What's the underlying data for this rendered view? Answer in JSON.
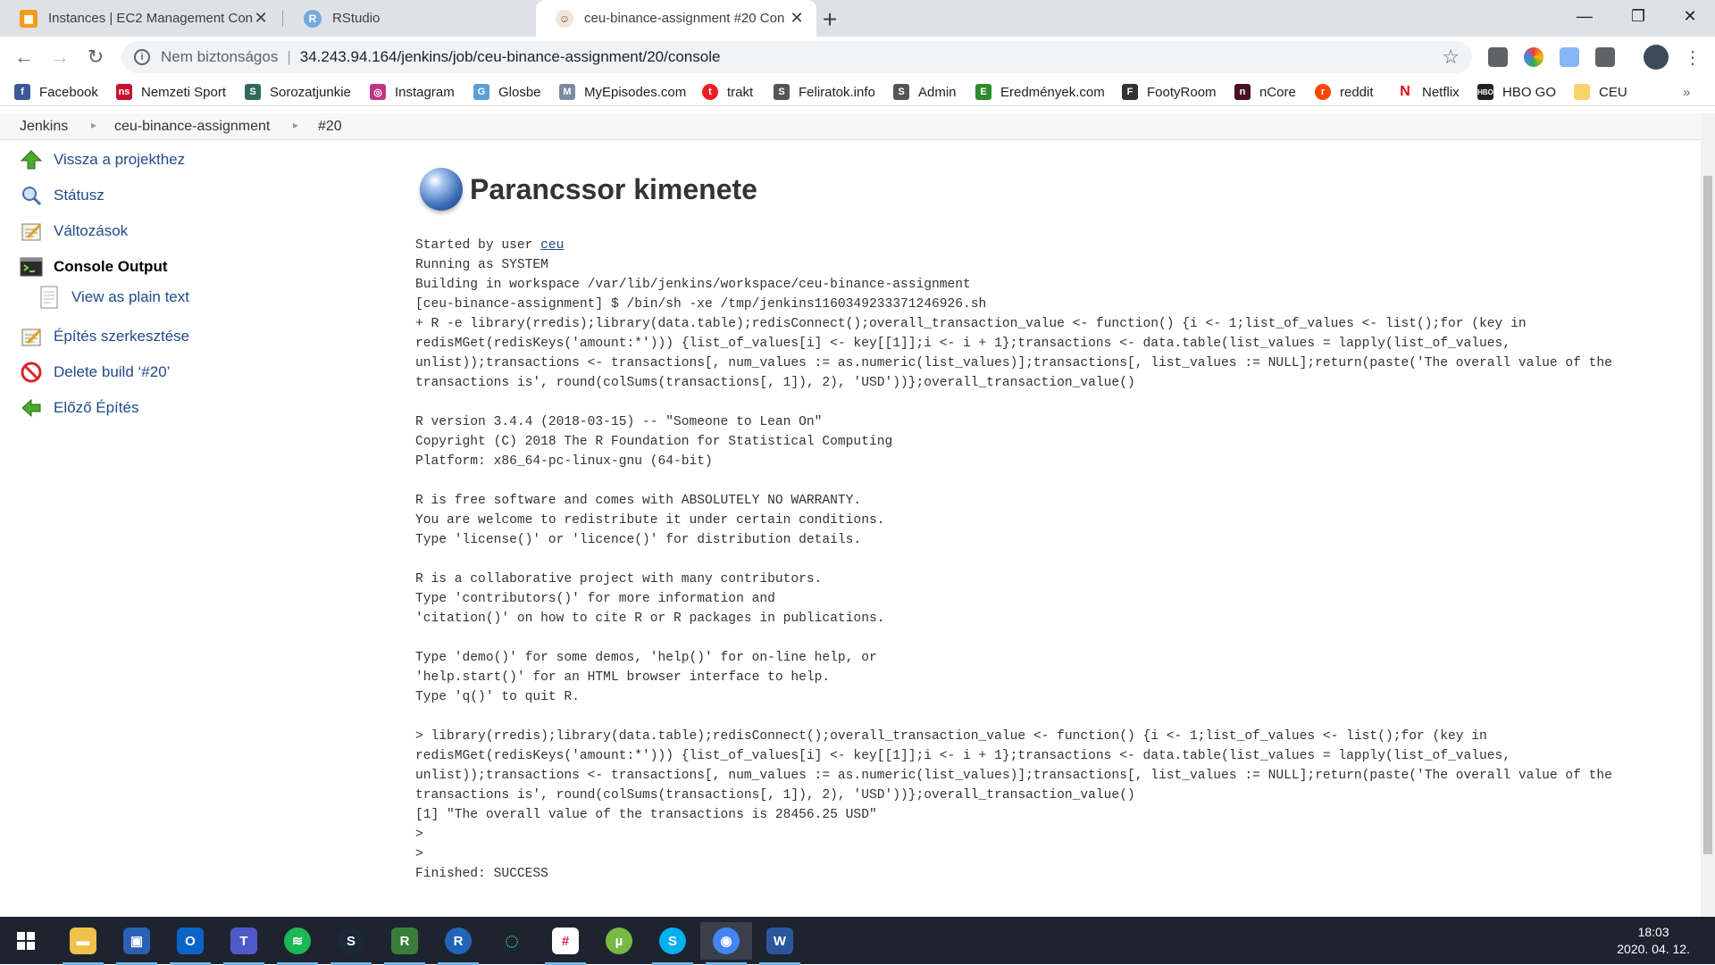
{
  "tabs": [
    {
      "title": "Instances | EC2 Management Con",
      "icon": "aws-icon",
      "color": "#f49b1c"
    },
    {
      "title": "RStudio",
      "icon": "rstudio-icon",
      "color": "#75aadb"
    },
    {
      "title": "ceu-binance-assignment #20 Con",
      "icon": "jenkins-icon",
      "color": "#d24939"
    }
  ],
  "omnibox": {
    "security_label": "Nem biztonságos",
    "url": "34.243.94.164/jenkins/job/ceu-binance-assignment/20/console"
  },
  "bookmarks": [
    {
      "label": "Facebook",
      "icon": "facebook-icon",
      "color": "#3b5998",
      "glyph": "f"
    },
    {
      "label": "Nemzeti Sport",
      "icon": "nemzeti-sport-icon",
      "color": "#c8102e",
      "glyph": "ns"
    },
    {
      "label": "Sorozatjunkie",
      "icon": "sorozatjunkie-icon",
      "color": "#2e6b5e",
      "glyph": "S"
    },
    {
      "label": "Instagram",
      "icon": "instagram-icon",
      "color": "#c13584",
      "glyph": "◎"
    },
    {
      "label": "Glosbe",
      "icon": "glosbe-icon",
      "color": "#5aa0d8",
      "glyph": "G"
    },
    {
      "label": "MyEpisodes.com",
      "icon": "myepisodes-icon",
      "color": "#7a8aa0",
      "glyph": "M"
    },
    {
      "label": "trakt",
      "icon": "trakt-icon",
      "color": "#ed1c24",
      "glyph": "t"
    },
    {
      "label": "Feliratok.info",
      "icon": "feliratok-icon",
      "color": "#555555",
      "glyph": "S"
    },
    {
      "label": "Admin",
      "icon": "admin-icon",
      "color": "#555555",
      "glyph": "S"
    },
    {
      "label": "Eredmények.com",
      "icon": "eredmenyek-icon",
      "color": "#2d8a2d",
      "glyph": "E"
    },
    {
      "label": "FootyRoom",
      "icon": "footyroom-icon",
      "color": "#333333",
      "glyph": "F"
    },
    {
      "label": "nCore",
      "icon": "ncore-icon",
      "color": "#4a0f22",
      "glyph": "n"
    },
    {
      "label": "reddit",
      "icon": "reddit-icon",
      "color": "#ff4500",
      "glyph": "r"
    },
    {
      "label": "Netflix",
      "icon": "netflix-icon",
      "color": "#e50914",
      "glyph": "N"
    },
    {
      "label": "HBO GO",
      "icon": "hbo-go-icon",
      "color": "#222222",
      "glyph": "H"
    },
    {
      "label": "CEU",
      "icon": "folder-icon",
      "color": "#f6d46b",
      "glyph": ""
    }
  ],
  "bookmarks_overflow": "»",
  "breadcrumb": [
    "Jenkins",
    "ceu-binance-assignment",
    "#20"
  ],
  "side_panel": [
    {
      "label": "Vissza a projekthez",
      "icon": "up-arrow-icon"
    },
    {
      "label": "Státusz",
      "icon": "search-icon"
    },
    {
      "label": "Változások",
      "icon": "notepad-icon"
    },
    {
      "label": "Console Output",
      "icon": "terminal-icon"
    },
    {
      "label": "View as plain text",
      "icon": "document-icon"
    },
    {
      "label": "Építés szerkesztése",
      "icon": "notepad-icon"
    },
    {
      "label": "Delete build ‘#20’",
      "icon": "no-entry-icon"
    },
    {
      "label": "Előző Építés",
      "icon": "left-arrow-icon"
    }
  ],
  "page_title": "Parancssor kimenete",
  "console": {
    "started_prefix": "Started by user ",
    "started_user": "ceu",
    "output": "Running as SYSTEM\nBuilding in workspace /var/lib/jenkins/workspace/ceu-binance-assignment\n[ceu-binance-assignment] $ /bin/sh -xe /tmp/jenkins1160349233371246926.sh\n+ R -e library(rredis);library(data.table);redisConnect();overall_transaction_value <- function() {i <- 1;list_of_values <- list();for (key in\nredisMGet(redisKeys('amount:*'))) {list_of_values[i] <- key[[1]];i <- i + 1};transactions <- data.table(list_values = lapply(list_of_values,\nunlist));transactions <- transactions[, num_values := as.numeric(list_values)];transactions[, list_values := NULL];return(paste('The overall value of the\ntransactions is', round(colSums(transactions[, 1]), 2), 'USD'))};overall_transaction_value()\n\nR version 3.4.4 (2018-03-15) -- \"Someone to Lean On\"\nCopyright (C) 2018 The R Foundation for Statistical Computing\nPlatform: x86_64-pc-linux-gnu (64-bit)\n\nR is free software and comes with ABSOLUTELY NO WARRANTY.\nYou are welcome to redistribute it under certain conditions.\nType 'license()' or 'licence()' for distribution details.\n\nR is a collaborative project with many contributors.\nType 'contributors()' for more information and\n'citation()' on how to cite R or R packages in publications.\n\nType 'demo()' for some demos, 'help()' for on-line help, or\n'help.start()' for an HTML browser interface to help.\nType 'q()' to quit R.\n\n> library(rredis);library(data.table);redisConnect();overall_transaction_value <- function() {i <- 1;list_of_values <- list();for (key in\nredisMGet(redisKeys('amount:*'))) {list_of_values[i] <- key[[1]];i <- i + 1};transactions <- data.table(list_values = lapply(list_of_values,\nunlist));transactions <- transactions[, num_values := as.numeric(list_values)];transactions[, list_values := NULL];return(paste('The overall value of the\ntransactions is', round(colSums(transactions[, 1]), 2), 'USD'))};overall_transaction_value()\n[1] \"The overall value of the transactions is 28456.25 USD\"\n>\n>\nFinished: SUCCESS"
  },
  "taskbar": {
    "apps": [
      {
        "name": "file-explorer-icon",
        "color": "#f0c24b",
        "glyph": "▬"
      },
      {
        "name": "save-icon",
        "color": "#2b5fb4",
        "glyph": "▣"
      },
      {
        "name": "outlook-icon",
        "color": "#0a64c8",
        "glyph": "O"
      },
      {
        "name": "teams-icon",
        "color": "#5059c9",
        "glyph": "T"
      },
      {
        "name": "spotify-icon",
        "color": "#1db954",
        "glyph": "≋"
      },
      {
        "name": "steam-icon",
        "color": "#1b2838",
        "glyph": "S"
      },
      {
        "name": "rstudio-app-icon",
        "color": "#3a7d3a",
        "glyph": "R"
      },
      {
        "name": "r-icon",
        "color": "#2165b6",
        "glyph": "R"
      },
      {
        "name": "loading-ring-icon",
        "color": "#1e2330",
        "glyph": "◌"
      },
      {
        "name": "slack-icon",
        "color": "#ffffff",
        "glyph": "#"
      },
      {
        "name": "utorrent-icon",
        "color": "#78b943",
        "glyph": "µ"
      },
      {
        "name": "skype-icon",
        "color": "#00aff0",
        "glyph": "S"
      },
      {
        "name": "chrome-icon",
        "color": "#4285f4",
        "glyph": "◉"
      },
      {
        "name": "word-icon",
        "color": "#2b579a",
        "glyph": "W"
      }
    ],
    "time": "18:03",
    "date": "2020. 04. 12."
  }
}
